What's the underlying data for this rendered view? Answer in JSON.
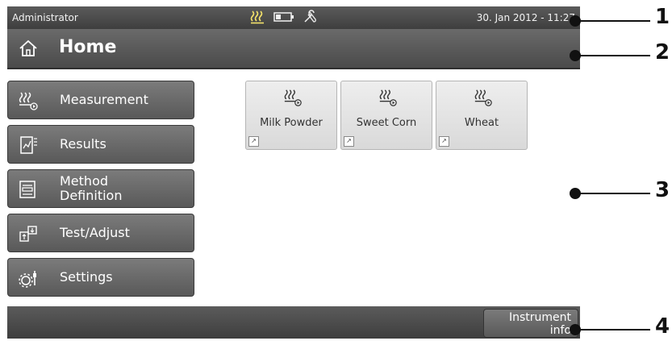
{
  "status_bar": {
    "user": "Administrator",
    "icons": [
      "heating-icon",
      "battery-icon",
      "service-tools-icon"
    ],
    "datetime": "30. Jan 2012 - 11:27"
  },
  "title_bar": {
    "title": "Home",
    "icon": "home-icon"
  },
  "nav": {
    "items": [
      {
        "label": "Measurement",
        "icon": "heating-play-icon"
      },
      {
        "label": "Results",
        "icon": "results-document-icon"
      },
      {
        "label_line1": "Method",
        "label_line2": "Definition",
        "icon": "method-definition-icon"
      },
      {
        "label": "Test/Adjust",
        "icon": "test-adjust-icon"
      },
      {
        "label": "Settings",
        "icon": "settings-gear-icon"
      }
    ]
  },
  "shortcuts": [
    {
      "label": "Milk Powder",
      "icon": "heating-play-icon"
    },
    {
      "label": "Sweet Corn",
      "icon": "heating-play-icon"
    },
    {
      "label": "Wheat",
      "icon": "heating-play-icon"
    }
  ],
  "bottom_bar": {
    "instrument_info_line1": "Instrument",
    "instrument_info_line2": "info"
  },
  "callouts": [
    "1",
    "2",
    "3",
    "4"
  ],
  "colors": {
    "bar_dark": "#4a4a4a",
    "button_gray": "#6b6b6b",
    "tile_light": "#e4e4e4"
  }
}
